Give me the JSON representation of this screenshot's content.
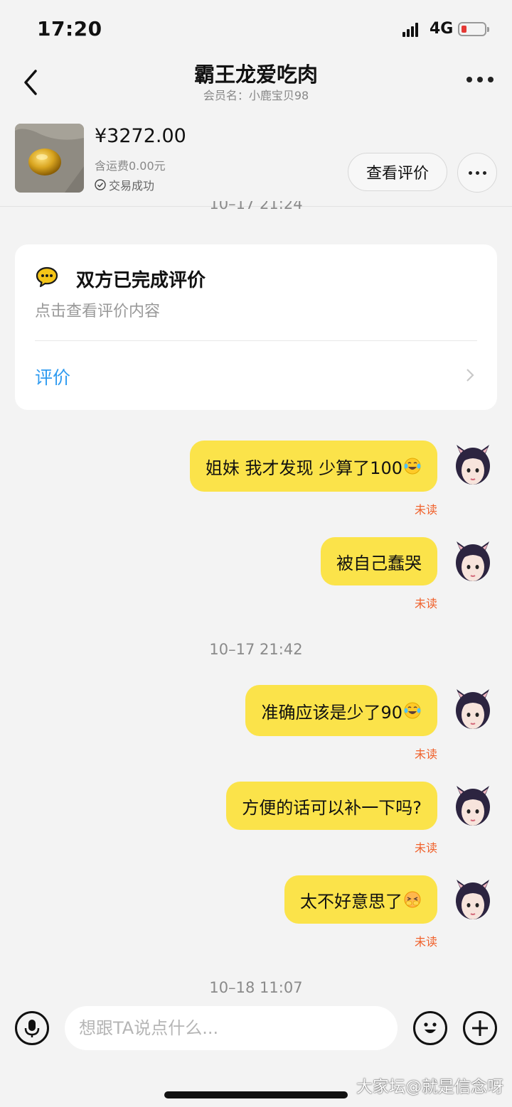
{
  "status_bar": {
    "time": "17:20",
    "network": "4G",
    "battery_color": "#e53935"
  },
  "header": {
    "title": "霸王龙爱吃肉",
    "subtitle": "会员名：小鹿宝贝98"
  },
  "product": {
    "price": "¥3272.00",
    "shipping": "含运费0.00元",
    "status": "交易成功",
    "review_button": "查看评价"
  },
  "timestamps": {
    "t1": "10–17 21:24",
    "t2": "10–17 21:42",
    "t3": "10–18 11:07"
  },
  "review_card": {
    "title": "双方已完成评价",
    "subtitle": "点击查看评价内容",
    "link": "评价"
  },
  "messages": [
    {
      "text": "姐妹 我才发现 少算了100",
      "emoji": "tears-of-joy-emoji",
      "status": "未读"
    },
    {
      "text": "被自己蠢哭",
      "status": "未读"
    },
    {
      "text": "准确应该是少了90",
      "emoji": "tears-of-joy-emoji",
      "status": "未读"
    },
    {
      "text": "方便的话可以补一下吗?",
      "status": "未读"
    },
    {
      "text": "太不好意思了",
      "emoji": "embarrassed-emoji",
      "status": "未读"
    }
  ],
  "input": {
    "placeholder": "想跟TA说点什么..."
  },
  "watermark": "大家坛@就是信念呀",
  "colors": {
    "bubble": "#fbe34a",
    "link": "#2f9bf0",
    "unread": "#f0602a"
  }
}
